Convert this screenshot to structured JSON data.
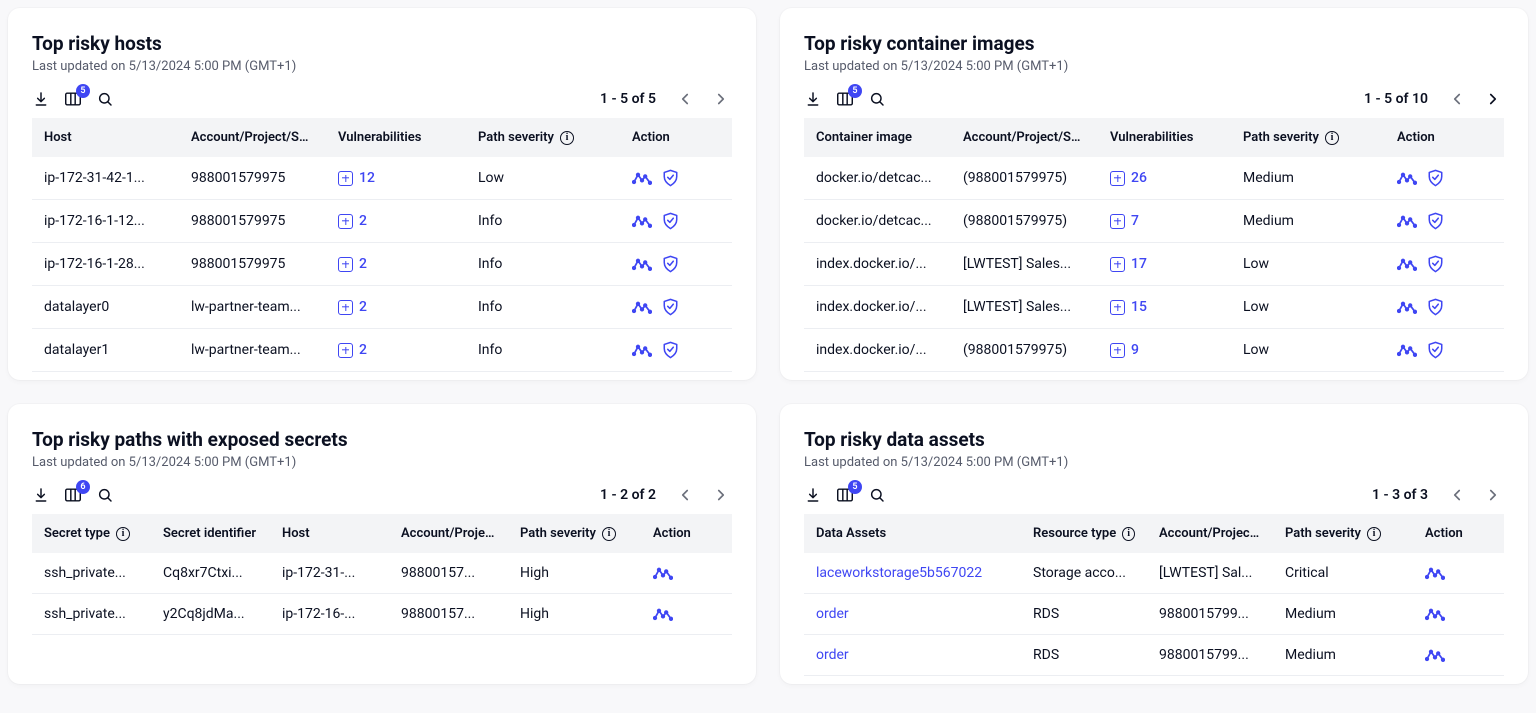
{
  "accent": "#3f46f3",
  "updated_text": "Last updated on 5/13/2024 5:00 PM (GMT+1)",
  "cols_badge": "5",
  "panels": {
    "hosts": {
      "title": "Top risky hosts",
      "pager": "1 - 5 of 5",
      "prev_active": false,
      "next_active": false,
      "headers": [
        "Host",
        "Account/Project/Subsc",
        "Vulnerabilities",
        "Path severity",
        "Action"
      ],
      "rows": [
        {
          "host": "ip-172-31-42-1...",
          "account": "988001579975",
          "vuln": "12",
          "sev": "Low"
        },
        {
          "host": "ip-172-16-1-12...",
          "account": "988001579975",
          "vuln": "2",
          "sev": "Info"
        },
        {
          "host": "ip-172-16-1-28...",
          "account": "988001579975",
          "vuln": "2",
          "sev": "Info"
        },
        {
          "host": "datalayer0",
          "account": "lw-partner-team...",
          "vuln": "2",
          "sev": "Info"
        },
        {
          "host": "datalayer1",
          "account": "lw-partner-team...",
          "vuln": "2",
          "sev": "Info"
        }
      ]
    },
    "images": {
      "title": "Top risky container images",
      "pager": "1 - 5 of 10",
      "prev_active": false,
      "next_active": true,
      "headers": [
        "Container image",
        "Account/Project/Subsc",
        "Vulnerabilities",
        "Path severity",
        "Action"
      ],
      "rows": [
        {
          "host": "docker.io/detcac...",
          "account": "(988001579975)",
          "vuln": "26",
          "sev": "Medium"
        },
        {
          "host": "docker.io/detcac...",
          "account": "(988001579975)",
          "vuln": "7",
          "sev": "Medium"
        },
        {
          "host": "index.docker.io/...",
          "account": "[LWTEST] Sales...",
          "vuln": "17",
          "sev": "Low"
        },
        {
          "host": "index.docker.io/...",
          "account": "[LWTEST] Sales...",
          "vuln": "15",
          "sev": "Low"
        },
        {
          "host": "index.docker.io/...",
          "account": "(988001579975)",
          "vuln": "9",
          "sev": "Low"
        }
      ]
    },
    "secrets": {
      "title": "Top risky paths with exposed secrets",
      "pager": "1 - 2 of 2",
      "prev_active": false,
      "next_active": false,
      "headers": [
        "Secret type",
        "Secret identifier",
        "Host",
        "Account/Project/S",
        "Path severity",
        "Action"
      ],
      "rows": [
        {
          "type": "ssh_private...",
          "id": "Cq8xr7Ctxi...",
          "host": "ip-172-31-...",
          "account": "98800157...",
          "sev": "High"
        },
        {
          "type": "ssh_private...",
          "id": "y2Cq8jdMa...",
          "host": "ip-172-16-...",
          "account": "98800157...",
          "sev": "High"
        }
      ]
    },
    "assets": {
      "title": "Top risky data assets",
      "pager": "1 - 3 of 3",
      "prev_active": false,
      "next_active": false,
      "headers": [
        "Data Assets",
        "Resource type",
        "Account/Project/Sub",
        "Path severity",
        "Action"
      ],
      "rows": [
        {
          "asset": "laceworkstorage5b567022",
          "rtype": "Storage acco...",
          "account": "[LWTEST] Sal...",
          "sev": "Critical"
        },
        {
          "asset": "order",
          "rtype": "RDS",
          "account": "9880015799...",
          "sev": "Medium"
        },
        {
          "asset": "order",
          "rtype": "RDS",
          "account": "9880015799...",
          "sev": "Medium"
        }
      ]
    }
  }
}
